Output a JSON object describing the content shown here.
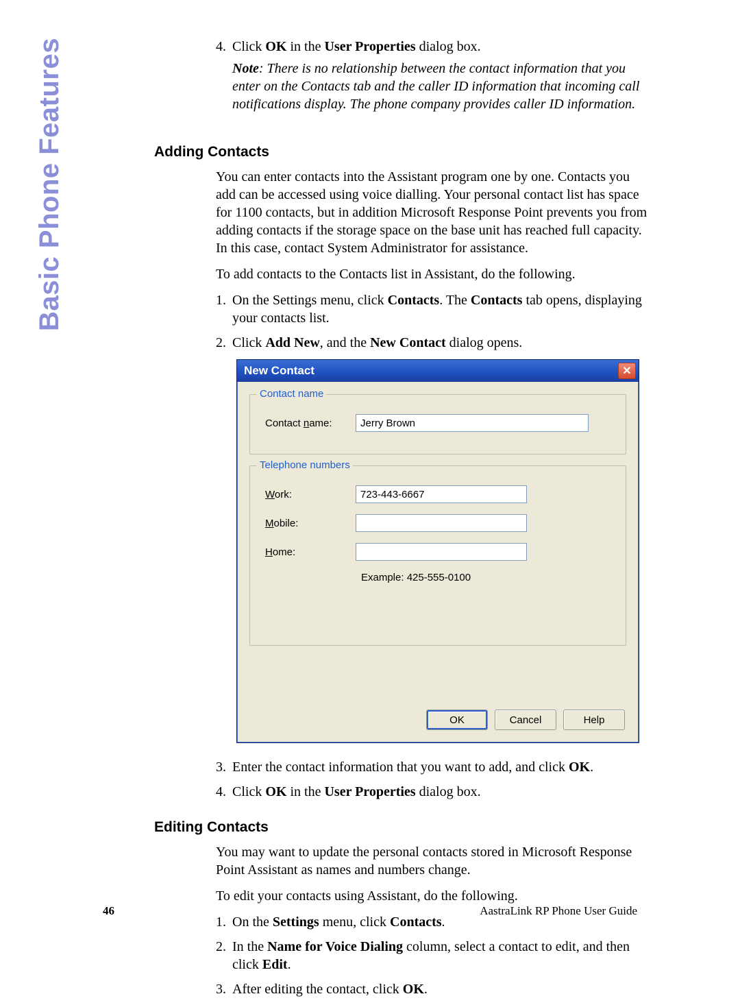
{
  "side_title": "Basic Phone Features",
  "top_step4": {
    "num": "4.",
    "pre": "Click ",
    "b1": "OK",
    "mid": " in the ",
    "b2": "User Properties",
    "post": " dialog box."
  },
  "note": {
    "label": "Note",
    "text": ": There is no relationship between the contact information that you enter on the Contacts tab and the caller ID information that incoming call notifications display. The phone company provides caller ID information."
  },
  "sections": {
    "adding": {
      "heading": "Adding Contacts",
      "p1": "You can enter contacts into the Assistant program one by one. Contacts you add can be accessed using voice dialling. Your personal contact list has space for 1100 contacts, but in addition Microsoft Response Point prevents you from adding contacts if the storage space on the base unit has reached full capacity. In this case, contact System Administrator for assistance.",
      "p2": "To add contacts to the Contacts list in Assistant, do the following.",
      "step1": {
        "num": "1.",
        "pre": "On the Settings menu, click ",
        "b1": "Contacts",
        "mid": ". The ",
        "b2": "Contacts",
        "post": " tab opens, displaying your contacts list."
      },
      "step2": {
        "num": "2.",
        "pre": "Click ",
        "b1": "Add New",
        "mid": ", and the ",
        "b2": "New Contact",
        "post": " dialog opens."
      },
      "step3": {
        "num": "3.",
        "pre": "Enter the contact information that you want to add, and click ",
        "b1": "OK",
        "post": "."
      },
      "step4": {
        "num": "4.",
        "pre": "Click ",
        "b1": "OK",
        "mid": " in the ",
        "b2": "User Properties",
        "post": " dialog box."
      }
    },
    "editing": {
      "heading": "Editing Contacts",
      "p1": "You may want to update the personal contacts stored in Microsoft Response Point Assistant as names and numbers change.",
      "p2": "To edit your contacts using Assistant, do the following.",
      "step1": {
        "num": "1.",
        "pre": "On the ",
        "b1": "Settings",
        "mid": " menu, click ",
        "b2": "Contacts",
        "post": "."
      },
      "step2": {
        "num": "2.",
        "pre": "In the ",
        "b1": "Name for Voice Dialing",
        "mid": " column, select a contact to edit, and then click ",
        "b2": "Edit",
        "post": "."
      },
      "step3": {
        "num": "3.",
        "pre": "After editing the contact, click ",
        "b1": "OK",
        "post": "."
      }
    }
  },
  "dialog": {
    "title": "New Contact",
    "close_label": "✕",
    "group_contact": "Contact name",
    "group_phone": "Telephone numbers",
    "labels": {
      "contact_name_pre": "Contact ",
      "contact_name_ul": "n",
      "contact_name_post": "ame:",
      "work_ul": "W",
      "work_post": "ork:",
      "mobile_ul": "M",
      "mobile_post": "obile:",
      "home_ul": "H",
      "home_post": "ome:"
    },
    "values": {
      "contact_name": "Jerry Brown",
      "work": "723-443-6667",
      "mobile": "",
      "home": ""
    },
    "example": "Example:  425-555-0100",
    "buttons": {
      "ok": "OK",
      "cancel": "Cancel",
      "help": "Help"
    }
  },
  "footer": {
    "page": "46",
    "doc": "AastraLink RP Phone User Guide"
  }
}
